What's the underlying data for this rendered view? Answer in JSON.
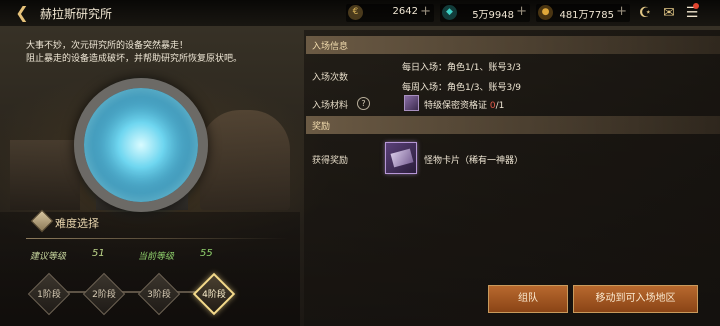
{
  "header": {
    "title": "赫拉斯研究所",
    "currencies": [
      {
        "icon": "gold-coin-icon",
        "symbol": "€",
        "value": "2642",
        "color": "#d9b45a"
      },
      {
        "icon": "cera-gem-icon",
        "symbol": "◆",
        "value": "5万9948",
        "color": "#3fd1c6"
      },
      {
        "icon": "coin-icon",
        "symbol": "●",
        "value": "481万7785",
        "color": "#e0a83a"
      }
    ],
    "plus": "+"
  },
  "description": [
    "大事不妙，次元研究所的设备突然暴走！",
    "阻止暴走的设备造成破坏，并帮助研究所恢复原状吧。"
  ],
  "difficulty": {
    "title": "难度选择",
    "recommended_label": "建议等级",
    "recommended_value": "51",
    "current_label": "当前等级",
    "current_value": "55",
    "stages": [
      "1阶段",
      "2阶段",
      "3阶段",
      "4阶段"
    ],
    "selected_stage": 3
  },
  "entry_info": {
    "title": "入场信息",
    "count_label": "入场次数",
    "daily": "每日入场：角色1/1、账号3/3",
    "weekly": "每周入场：角色1/3、账号3/9",
    "material_label": "入场材料",
    "help": "?",
    "material_name": "特级保密资格证",
    "material_have": "0",
    "material_need": "/1"
  },
  "reward": {
    "title": "奖励",
    "label": "获得奖励",
    "item": "怪物卡片（稀有一神器）"
  },
  "buttons": {
    "party": "组队",
    "move": "移动到可入场地区"
  }
}
